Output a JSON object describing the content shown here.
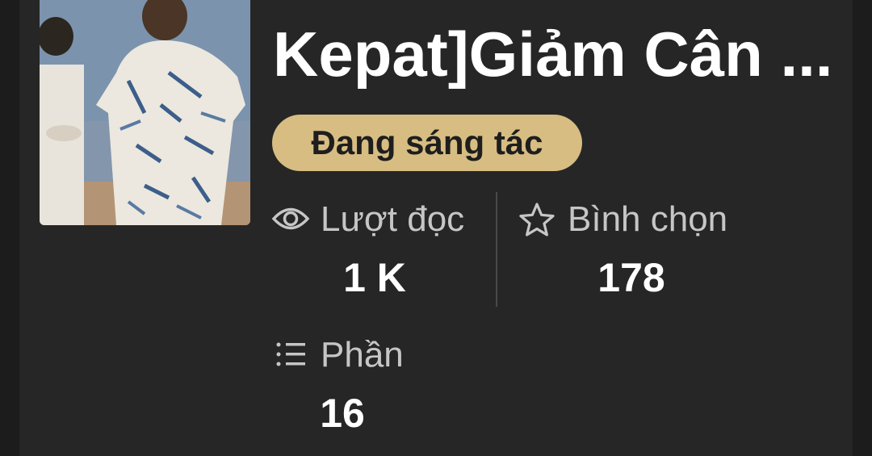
{
  "story": {
    "title": "Kepat]Giảm Cân ...",
    "status": "Đang sáng tác",
    "cover_icon": "cover-image"
  },
  "stats": {
    "reads": {
      "label": "Lượt đọc",
      "value": "1 K",
      "icon": "eye-icon"
    },
    "votes": {
      "label": "Bình chọn",
      "value": "178",
      "icon": "star-icon"
    },
    "parts": {
      "label": "Phần",
      "value": "16",
      "icon": "list-icon"
    }
  },
  "colors": {
    "background": "#262626",
    "badge": "#d7bd82",
    "label": "#c6c6c6",
    "value": "#ffffff"
  }
}
